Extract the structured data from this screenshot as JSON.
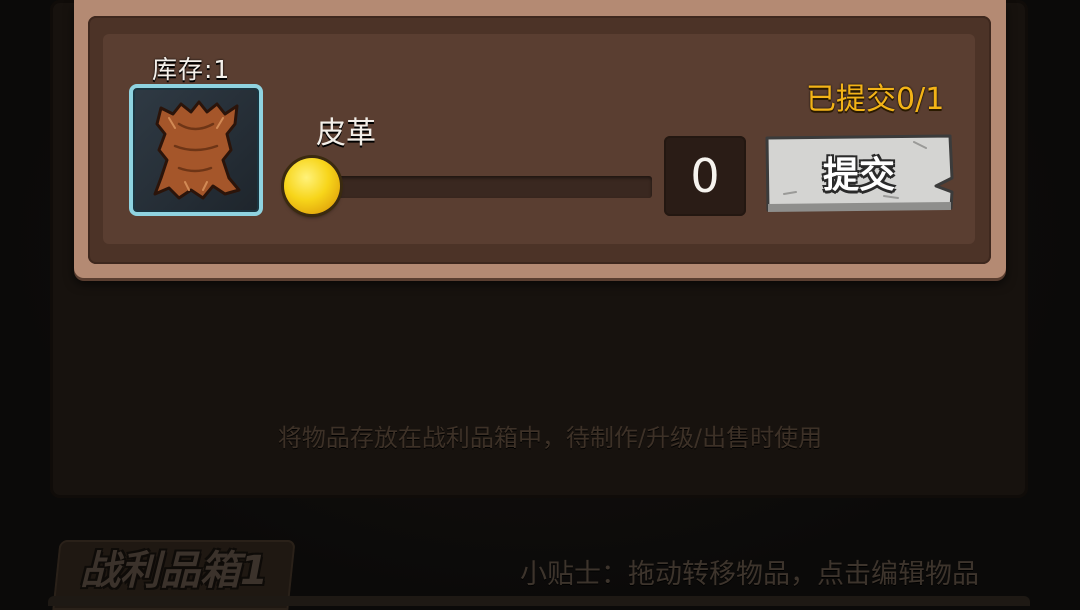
{
  "item": {
    "stock_label": "库存:1",
    "name": "皮革",
    "icon": "leather-hide-icon",
    "submitted_label": "已提交0/1",
    "quantity": "0",
    "slider_fraction": 0,
    "submit_label": "提交"
  },
  "hint": "将物品存放在战利品箱中，待制作/升级/出售时使用",
  "loot_box": {
    "title": "战利品箱1",
    "tip": "小贴士：拖动转移物品，点击编辑物品"
  },
  "colors": {
    "submitted_text": "#f3b317",
    "slot_border": "#8fd3e0",
    "card_outer": "#b48a73",
    "card_inner": "#4c3327"
  }
}
